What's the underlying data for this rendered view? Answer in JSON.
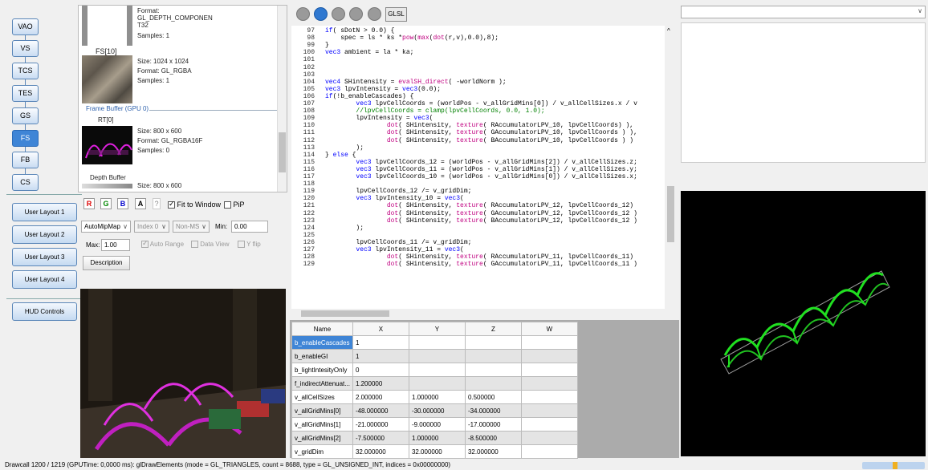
{
  "stages": [
    {
      "label": "VAO",
      "active": false
    },
    {
      "label": "VS",
      "active": false
    },
    {
      "label": "TCS",
      "active": false
    },
    {
      "label": "TES",
      "active": false
    },
    {
      "label": "GS",
      "active": false
    },
    {
      "label": "FS",
      "active": true
    },
    {
      "label": "FB",
      "active": false
    },
    {
      "label": "CS",
      "active": false
    }
  ],
  "layouts": [
    "User Layout 1",
    "User Layout 2",
    "User Layout 3",
    "User Layout 4"
  ],
  "hud": "HUD Controls",
  "textures": {
    "tex0": {
      "format": "Format:",
      "format_value": "GL_DEPTH_COMPONEN",
      "format_cont": "T32",
      "samples": "Samples: 1"
    },
    "tex1": {
      "label": "FS[10]",
      "size": "Size: 1024 x 1024",
      "format": "Format: GL_RGBA",
      "samples": "Samples: 1"
    },
    "fb_header": "Frame Buffer (GPU 0)",
    "rt0": {
      "label": "RT[0]",
      "size": "Size: 800 x 600",
      "format": "Format: GL_RGBA16F",
      "samples": "Samples: 0"
    },
    "depth": {
      "label": "Depth Buffer",
      "size": "Size: 800 x 600"
    }
  },
  "controls": {
    "r": "R",
    "g": "G",
    "b": "B",
    "a": "A",
    "help": "?",
    "fit_label": "Fit to Window",
    "pip_label": "PiP",
    "mipmap": "AutoMipMap",
    "index": "Index 0",
    "nonms": "Non-MS",
    "min_label": "Min:",
    "min_value": "0.00",
    "max_label": "Max:",
    "max_value": "1.00",
    "auto_range": "Auto Range",
    "data_view": "Data View",
    "yflip": "Y flip",
    "description": "Description"
  },
  "toolbar": {
    "glsl": "GLSL"
  },
  "code": [
    {
      "n": "97",
      "t": "if( sDotN > 0.0) {"
    },
    {
      "n": "98",
      "t": "    spec = ls * ks *pow(max(dot(r,v),0.0),8);"
    },
    {
      "n": "99",
      "t": "}"
    },
    {
      "n": "100",
      "t": "vec3 ambient = la * ka;"
    },
    {
      "n": "101",
      "t": ""
    },
    {
      "n": "102",
      "t": ""
    },
    {
      "n": "103",
      "t": ""
    },
    {
      "n": "104",
      "t": "vec4 SHintensity = evalSH_direct( -worldNorm );"
    },
    {
      "n": "105",
      "t": "vec3 lpvIntensity = vec3(0.0);"
    },
    {
      "n": "106",
      "t": "if(!b_enableCascades) {"
    },
    {
      "n": "107",
      "t": "        vec3 lpvCellCoords = (worldPos - v_allGridMins[0]) / v_allCellSizes.x / v"
    },
    {
      "n": "108",
      "t": "        //lpvCellCoords = clamp(lpvCellCoords, 0.0, 1.0);"
    },
    {
      "n": "109",
      "t": "        lpvIntensity = vec3("
    },
    {
      "n": "110",
      "t": "                dot( SHintensity, texture( RAccumulatorLPV_10, lpvCellCoords) ),"
    },
    {
      "n": "111",
      "t": "                dot( SHintensity, texture( GAccumulatorLPV_10, lpvCellCoords ) ),"
    },
    {
      "n": "112",
      "t": "                dot( SHintensity, texture( BAccumulatorLPV_10, lpvCellCoords ) )"
    },
    {
      "n": "113",
      "t": "        );"
    },
    {
      "n": "114",
      "t": "} else {"
    },
    {
      "n": "115",
      "t": "        vec3 lpvCellCoords_12 = (worldPos - v_allGridMins[2]) / v_allCellSizes.z;"
    },
    {
      "n": "116",
      "t": "        vec3 lpvCellCoords_11 = (worldPos - v_allGridMins[1]) / v_allCellSizes.y;"
    },
    {
      "n": "117",
      "t": "        vec3 lpvCellCoords_10 = (worldPos - v_allGridMins[0]) / v_allCellSizes.x;"
    },
    {
      "n": "118",
      "t": ""
    },
    {
      "n": "119",
      "t": "        lpvCellCoords_12 /= v_gridDim;"
    },
    {
      "n": "120",
      "t": "        vec3 lpvIntensity_10 = vec3("
    },
    {
      "n": "121",
      "t": "                dot( SHintensity, texture( RAccumulatorLPV_12, lpvCellCoords_12)"
    },
    {
      "n": "122",
      "t": "                dot( SHintensity, texture( GAccumulatorLPV_12, lpvCellCoords_12 )"
    },
    {
      "n": "123",
      "t": "                dot( SHintensity, texture( BAccumulatorLPV_12, lpvCellCoords_12 )"
    },
    {
      "n": "124",
      "t": "        );"
    },
    {
      "n": "125",
      "t": ""
    },
    {
      "n": "126",
      "t": "        lpvCellCoords_11 /= v_gridDim;"
    },
    {
      "n": "127",
      "t": "        vec3 lpvIntensity_11 = vec3("
    },
    {
      "n": "128",
      "t": "                dot( SHintensity, texture( RAccumulatorLPV_11, lpvCellCoords_11)"
    },
    {
      "n": "129",
      "t": "                dot( SHintensity, texture( GAccumulatorLPV_11, lpvCellCoords_11 )"
    }
  ],
  "uniforms": {
    "headers": [
      "Name",
      "X",
      "Y",
      "Z",
      "W"
    ],
    "rows": [
      {
        "name": "b_enableCascades",
        "x": "1",
        "y": "",
        "z": "",
        "w": ""
      },
      {
        "name": "b_enableGI",
        "x": "1",
        "y": "",
        "z": "",
        "w": ""
      },
      {
        "name": "b_lightIntesityOnly",
        "x": "0",
        "y": "",
        "z": "",
        "w": ""
      },
      {
        "name": "f_indirectAttenuat...",
        "x": "1.200000",
        "y": "",
        "z": "",
        "w": ""
      },
      {
        "name": "v_allCellSizes",
        "x": "2.000000",
        "y": "1.000000",
        "z": "0.500000",
        "w": ""
      },
      {
        "name": "v_allGridMins[0]",
        "x": "-48.000000",
        "y": "-30.000000",
        "z": "-34.000000",
        "w": ""
      },
      {
        "name": "v_allGridMins[1]",
        "x": "-21.000000",
        "y": "-9.000000",
        "z": "-17.000000",
        "w": ""
      },
      {
        "name": "v_allGridMins[2]",
        "x": "-7.500000",
        "y": "1.000000",
        "z": "-8.500000",
        "w": ""
      },
      {
        "name": "v_gridDim",
        "x": "32.000000",
        "y": "32.000000",
        "z": "32.000000",
        "w": ""
      }
    ]
  },
  "status": "Drawcall 1200 / 1219 (GPUTime: 0,0000 ms): glDrawElements (mode = GL_TRIANGLES, count = 8688, type = GL_UNSIGNED_INT, indices = 0x00000000)"
}
